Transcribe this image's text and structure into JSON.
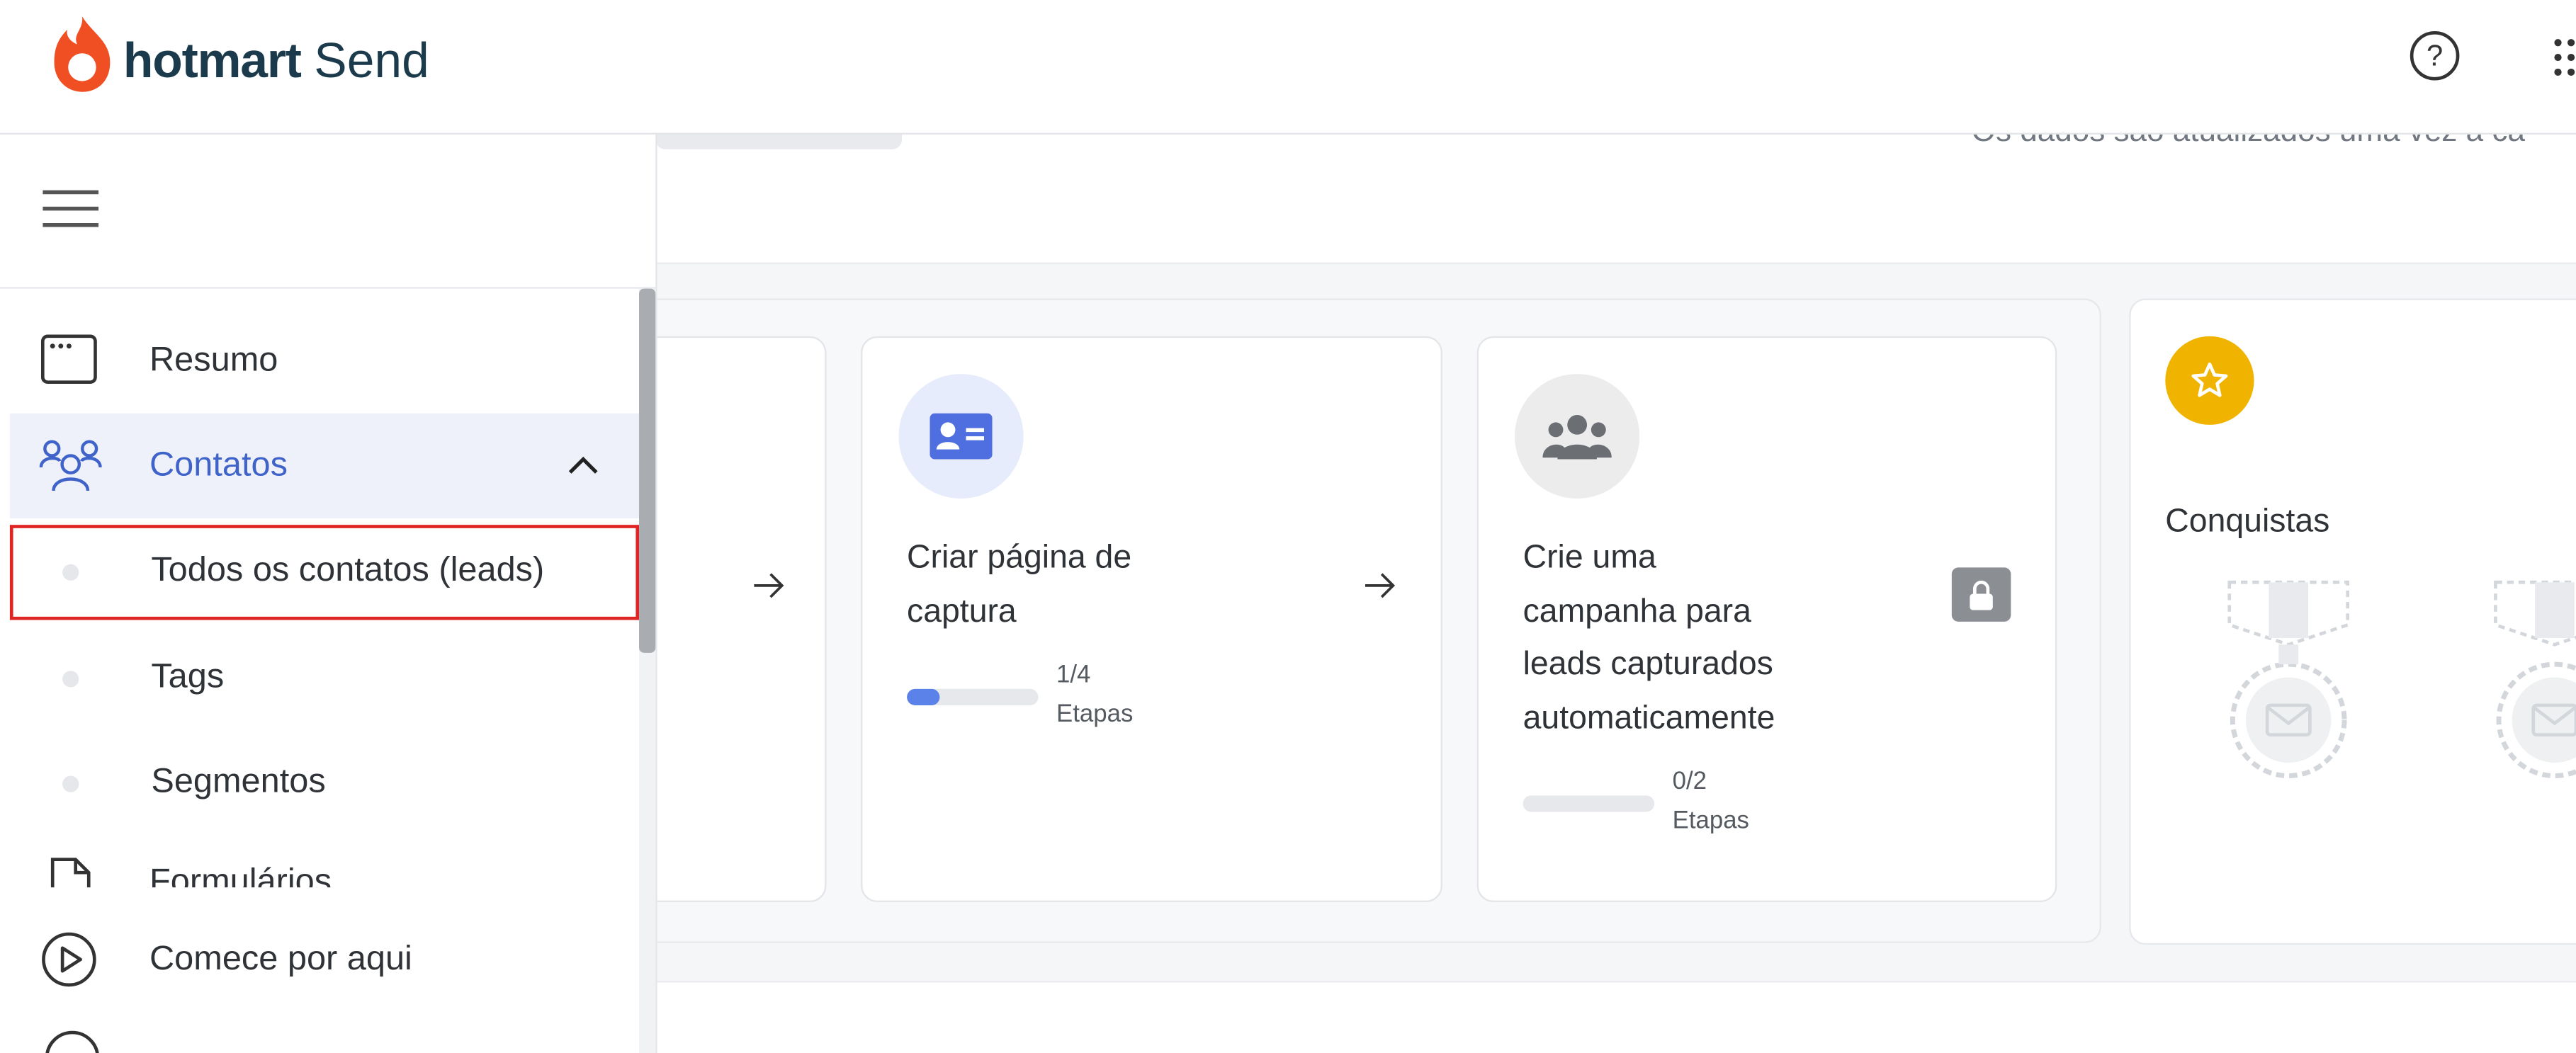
{
  "header": {
    "brand_bold": "hotmart",
    "brand_light": "Send",
    "help_label": "?",
    "icons": [
      "hotmart-flame-icon",
      "help-icon",
      "apps-grid-icon"
    ]
  },
  "main": {
    "data_note": "Os dados são atualizados uma vez a ca",
    "steps": [
      {
        "title": "Criar página de captura",
        "progress": "1/4",
        "progress_fraction": 0.25,
        "steps_label": "Etapas",
        "icon": "id-card-icon"
      },
      {
        "title": "Crie uma campanha para leads capturados automaticamente",
        "progress": "0/2",
        "progress_fraction": 0,
        "steps_label": "Etapas",
        "icon": "users-group-icon",
        "locked": true
      }
    ],
    "achievements": {
      "title": "Conquistas",
      "icon": "star-icon"
    }
  },
  "sidebar": {
    "menu_icon": "hamburger-icon",
    "items": [
      {
        "label": "Resumo",
        "icon": "browser-window-icon"
      },
      {
        "label": "Contatos",
        "icon": "contacts-group-icon",
        "expanded": true
      },
      {
        "label": "Formulários",
        "icon": "form-document-icon"
      }
    ],
    "sub_items": [
      {
        "label": "Todos os contatos (leads)",
        "selected": true
      },
      {
        "label": "Tags"
      },
      {
        "label": "Segmentos"
      }
    ],
    "start_item": {
      "label": "Comece por aqui",
      "icon": "play-circle-icon"
    }
  },
  "colors": {
    "accent": "#3f63c9",
    "brand_flame": "#f04e23",
    "brand_text": "#1b3a4b",
    "achievement_star": "#f0b400",
    "selection_outline": "#e02424"
  }
}
